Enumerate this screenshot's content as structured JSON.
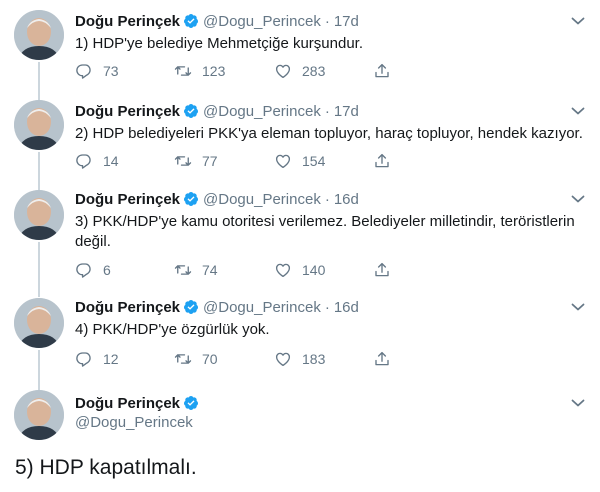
{
  "user": {
    "name": "Doğu Perinçek",
    "handle": "@Dogu_Perincek"
  },
  "separator": "·",
  "tweets": [
    {
      "time": "17d",
      "text": "1) HDP'ye belediye Mehmetçiğe kurşundur.",
      "replies": "73",
      "retweets": "123",
      "likes": "283"
    },
    {
      "time": "17d",
      "text": "2) HDP belediyeleri PKK'ya eleman topluyor, haraç topluyor, hendek kazıyor.",
      "replies": "14",
      "retweets": "77",
      "likes": "154"
    },
    {
      "time": "16d",
      "text": "3) PKK/HDP'ye kamu otoritesi verilemez. Belediyeler milletindir, teröristlerin değil.",
      "replies": "6",
      "retweets": "74",
      "likes": "140"
    },
    {
      "time": "16d",
      "text": "4) PKK/HDP'ye özgürlük yok.",
      "replies": "12",
      "retweets": "70",
      "likes": "183"
    }
  ],
  "expanded_tweet": {
    "text": "5) HDP kapatılmalı."
  },
  "colors": {
    "text": "#14171a",
    "secondary": "#657786",
    "verified": "#1da1f2",
    "thread_line": "#ccd6dd"
  },
  "icons": [
    "verified-badge-icon",
    "chevron-down-icon",
    "reply-icon",
    "retweet-icon",
    "like-icon",
    "share-icon"
  ]
}
